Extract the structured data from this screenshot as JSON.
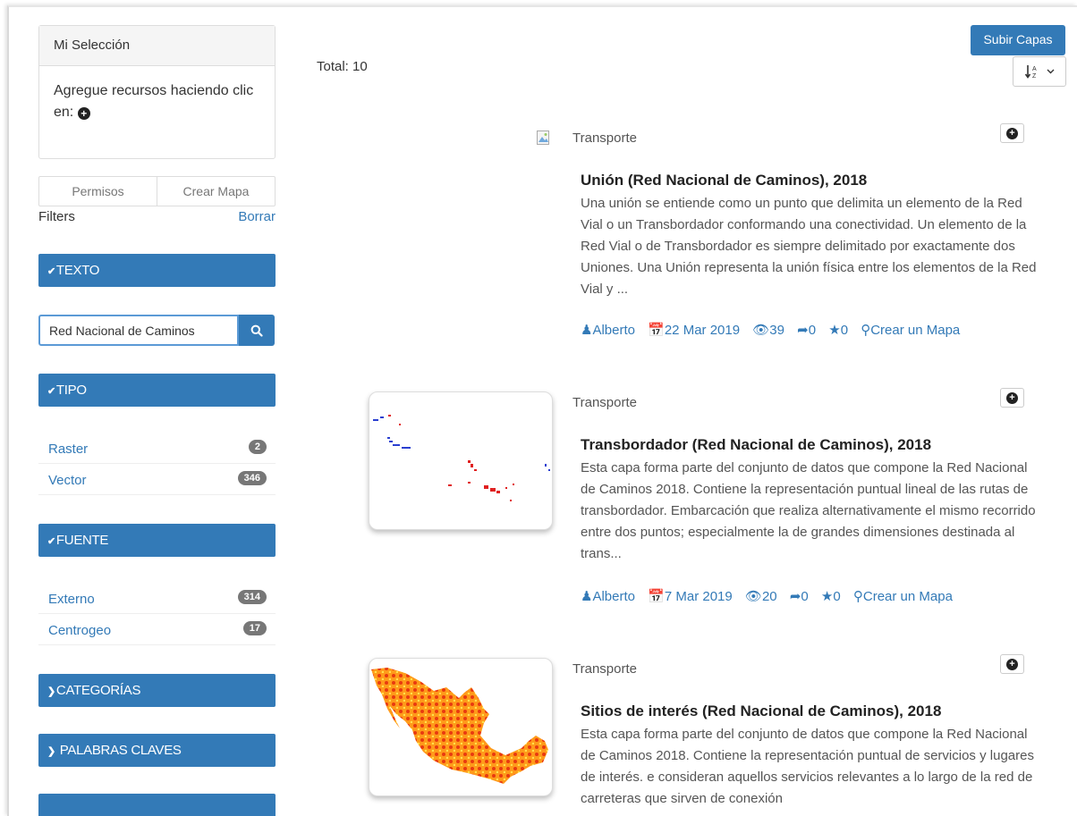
{
  "selection": {
    "title": "Mi Selección",
    "body": "Agregue recursos haciendo clic en:",
    "plus_icon": "plus-circle-icon"
  },
  "tabs": {
    "permisos": "Permisos",
    "crear_mapa": "Crear Mapa"
  },
  "filters": {
    "label": "Filters",
    "clear": "Borrar"
  },
  "facets": {
    "texto": "TEXTO",
    "tipo": "TIPO",
    "fuente": "FUENTE",
    "categorias": "CATEGORÍAS",
    "palabras": "PALABRAS CLAVES"
  },
  "search": {
    "value": "Red Nacional de Caminos"
  },
  "tipo_items": [
    {
      "label": "Raster",
      "count": "2"
    },
    {
      "label": "Vector",
      "count": "346"
    }
  ],
  "fuente_items": [
    {
      "label": "Externo",
      "count": "314"
    },
    {
      "label": "Centrogeo",
      "count": "17"
    }
  ],
  "main": {
    "total": "Total: 10",
    "upload_label": "Subir Capas",
    "sort_icon": "sort-alpha-icon"
  },
  "results": [
    {
      "category": "Transporte",
      "title": "Unión (Red Nacional de Caminos), 2018",
      "description": "Una unión se entiende como un punto que delimita un elemento de la Red Vial o un Transbordador conformando una conectividad.  Un elemento de la Red Vial o de Transbordador es siempre delimitado por exactamente dos Uniones. Una Unión representa la unión física entre los elementos de la Red Vial y ...",
      "author": "Alberto",
      "date": "22 Mar 2019",
      "views": "39",
      "shares": "0",
      "stars": "0",
      "map_link": "Crear un Mapa"
    },
    {
      "category": "Transporte",
      "title": "Transbordador (Red Nacional de Caminos), 2018",
      "description": "Esta capa forma parte del conjunto de datos que compone la Red Nacional de Caminos 2018. Contiene la representación puntual lineal de las rutas de transbordador. Embarcación que realiza alternativamente el mismo recorrido entre dos puntos; especialmente la de grandes dimensiones destinada al trans...",
      "author": "Alberto",
      "date": "7 Mar 2019",
      "views": "20",
      "shares": "0",
      "stars": "0",
      "map_link": "Crear un Mapa"
    },
    {
      "category": "Transporte",
      "title": "Sitios de interés (Red Nacional de Caminos), 2018",
      "description": "Esta capa forma parte del conjunto de datos que compone la Red Nacional de Caminos 2018. Contiene la representación puntual de servicios y lugares de interés.  e consideran aquellos servicios relevantes a lo largo de la red de carreteras que sirven de conexión"
    }
  ],
  "colors": {
    "primary": "#337ab7",
    "badge": "#777777"
  }
}
